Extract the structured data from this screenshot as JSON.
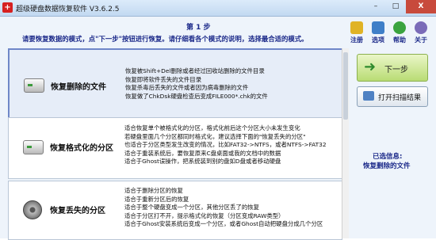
{
  "window": {
    "title": "超级硬盘数据恢复软件 V3.6.2.5",
    "app_icon": "recovery-app-icon",
    "buttons": {
      "minimize": "–",
      "maximize": "□",
      "close": "X"
    }
  },
  "header": {
    "step_title": "第 1 步",
    "instruction": "请要恢复数据的模式，点\"下一步\"按钮进行恢复。请仔细看各个模式的说明，选择最合适的模式。"
  },
  "toolbar": {
    "items": [
      {
        "label": "注册",
        "icon": "register-icon",
        "color": "#e0b325"
      },
      {
        "label": "选项",
        "icon": "options-icon",
        "color": "#3f7fc8"
      },
      {
        "label": "帮助",
        "icon": "help-icon",
        "color": "#3aa33f"
      },
      {
        "label": "关于",
        "icon": "about-icon",
        "color": "#7a6bb8"
      }
    ]
  },
  "modes": [
    {
      "title": "恢复删除的文件",
      "icon": "hard-drive-icon",
      "selected": true,
      "lines": [
        "恢复被Shift+Del删除或者经过回收站删除的文件目录",
        "恢复即将软件丢失的文件目录",
        "恢复杀毒后丢失的文件或者因为病毒删除的文件",
        "恢复做了ChkDsk硬盘检查后变成FILE000*.chk的文件"
      ]
    },
    {
      "title": "恢复格式化的分区",
      "icon": "hard-drive-icon",
      "selected": false,
      "lines": [
        "适合恢复单个被格式化的分区，格式化前后这个分区大小未发生变化",
        "若硬盘里面几个分区都同时格式化，建议选择下面的\"恢复丢失的分区\"",
        "也适合于分区类型发生改变的情况，比如FAT32->NTFS，或者NTFS->FAT32",
        "适合于重装系统后，要恢复原来C盘桌面或我的文档中的数据",
        "适合于Ghost误操作，把系统装到别的盘如D盘或者移动硬盘"
      ]
    },
    {
      "title": "恢复丢失的分区",
      "icon": "disk-platter-icon",
      "selected": false,
      "lines": [
        "适合于删除分区的恢复",
        "适合于重新分区后的恢复",
        "适合于整个硬盘变成一个分区，其他分区丢了的恢复",
        "适合于分区打不开，提示格式化的恢复（分区变成RAW类型）",
        "适合于Ghost安装系统后变成一个分区，或者Ghost自动把硬盘分成几个分区"
      ]
    }
  ],
  "actions": {
    "next_label": "下一步",
    "next_icon": "next-arrow-icon",
    "open_scan_label": "打开扫描结果",
    "open_scan_icon": "open-folder-icon"
  },
  "selection": {
    "label": "已选信息:",
    "value": "恢复删除的文件"
  },
  "colors": {
    "accent": "#1c2a8a",
    "selected_border": "#6f87c8",
    "next_button": "#b9dc74"
  }
}
